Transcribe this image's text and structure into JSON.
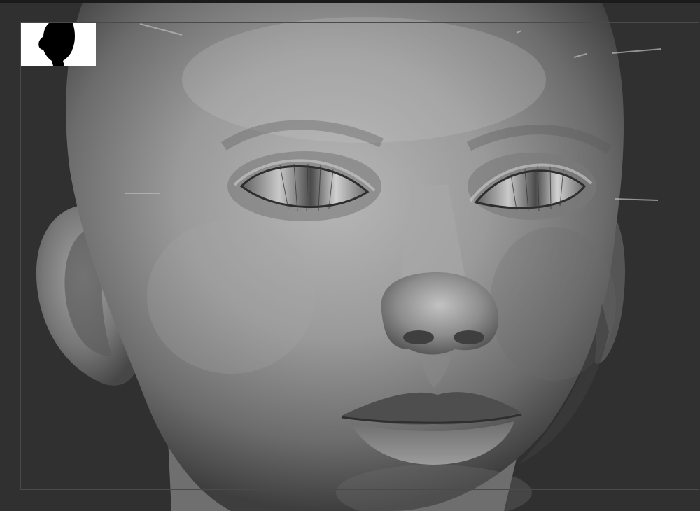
{
  "app": {
    "name": "",
    "background_color": "#303030",
    "frame_color": "#4a4a4a"
  },
  "viewport": {
    "subject": "",
    "material_color": "#8a8a8a",
    "shadow_color": "#2a2a2a"
  },
  "navigator": {
    "icon": "head-silhouette-icon",
    "background_color": "#ffffff",
    "silhouette_color": "#000000"
  }
}
